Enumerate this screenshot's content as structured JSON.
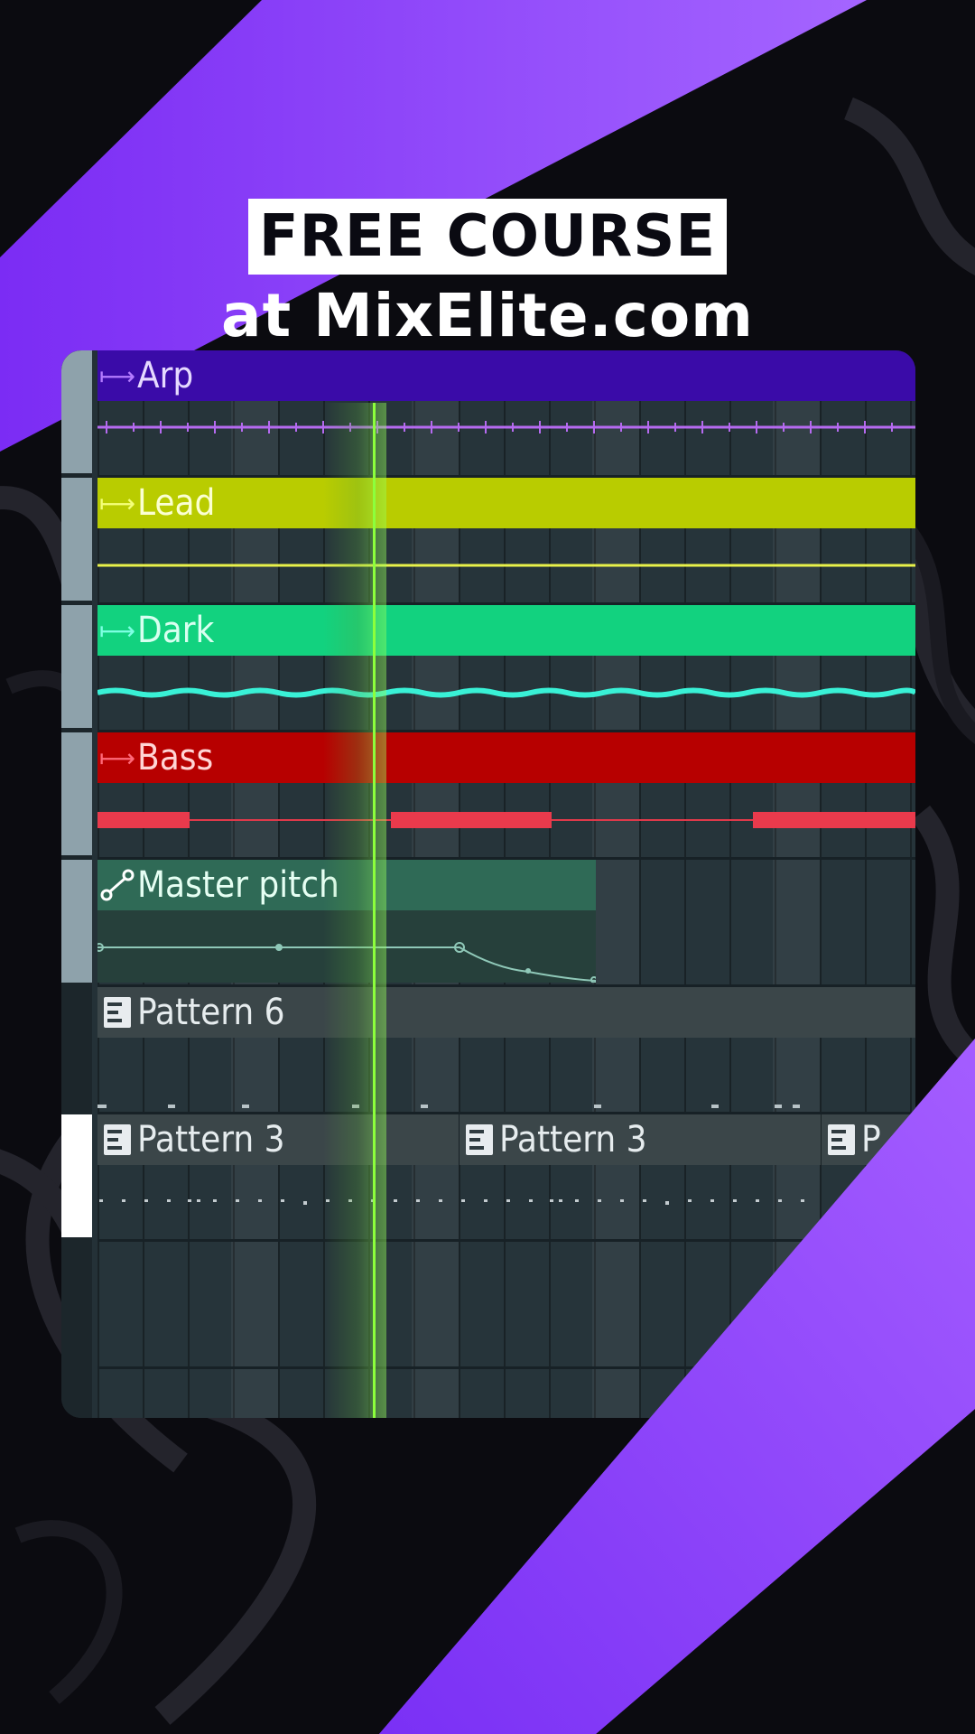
{
  "promo": {
    "title": "FREE COURSE",
    "subtitle": "at MixElite.com"
  },
  "colors": {
    "accent_purple": "#8b45ff",
    "arp": "#3a0ba8",
    "lead": "#b9cc00",
    "dark": "#12d27f",
    "bass": "#b70000",
    "automation": "#2f6a56",
    "pattern": "#3b4649",
    "playhead": "#8cff3c"
  },
  "playlist": {
    "tracks": [
      {
        "name": "Arp",
        "icon": "audio-clip-icon"
      },
      {
        "name": "Lead",
        "icon": "audio-clip-icon"
      },
      {
        "name": "Dark",
        "icon": "audio-clip-icon"
      },
      {
        "name": "Bass",
        "icon": "audio-clip-icon"
      },
      {
        "name": "Master pitch",
        "icon": "automation-clip-icon"
      },
      {
        "name": "Pattern 6",
        "icon": "pattern-clip-icon"
      },
      {
        "name": "Pattern 3",
        "icon": "pattern-clip-icon"
      },
      {
        "name": "Pattern 3",
        "icon": "pattern-clip-icon"
      },
      {
        "name": "P",
        "icon": "pattern-clip-icon"
      }
    ]
  }
}
